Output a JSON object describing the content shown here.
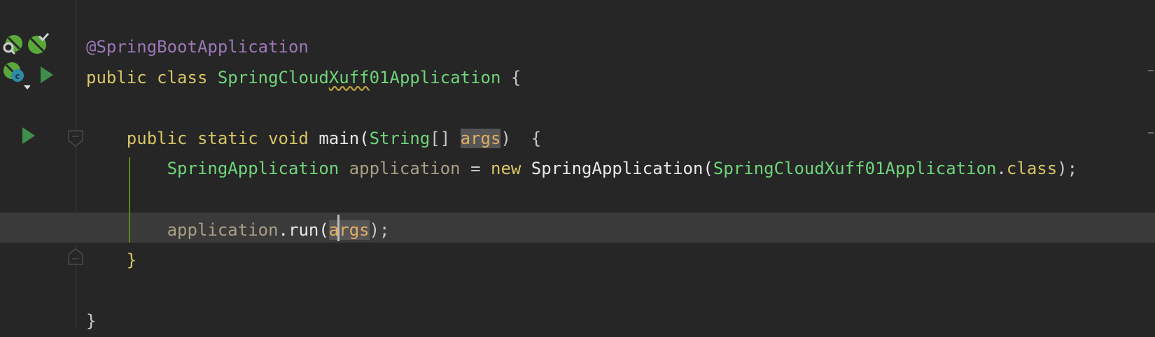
{
  "editor": {
    "lines": [
      [
        {
          "t": "@SpringBootApplication",
          "k": "annotation"
        }
      ],
      [
        {
          "t": "public class ",
          "k": "keyword"
        },
        {
          "t": "SpringCloud",
          "k": "class"
        },
        {
          "t": "Xuff",
          "k": "class typo"
        },
        {
          "t": "01Application",
          "k": "class"
        },
        {
          "t": " {",
          "k": "plain"
        }
      ],
      [],
      [
        {
          "t": "    public static void ",
          "k": "keyword"
        },
        {
          "t": "main(",
          "k": "method"
        },
        {
          "t": "String",
          "k": "class"
        },
        {
          "t": "[] ",
          "k": "plain"
        },
        {
          "t": "args",
          "k": "param-hl"
        },
        {
          "t": ")  {",
          "k": "plain"
        }
      ],
      [
        {
          "t": "        SpringApplication ",
          "k": "class"
        },
        {
          "t": "application",
          "k": "var"
        },
        {
          "t": " = ",
          "k": "plain"
        },
        {
          "t": "new ",
          "k": "keyword"
        },
        {
          "t": "SpringApplication(",
          "k": "method"
        },
        {
          "t": "SpringCloudXuff01Application",
          "k": "class"
        },
        {
          "t": ".",
          "k": "plain"
        },
        {
          "t": "class",
          "k": "keyword"
        },
        {
          "t": ");",
          "k": "plain"
        }
      ],
      [],
      [
        {
          "t": "        application",
          "k": "var"
        },
        {
          "t": ".run(",
          "k": "method"
        },
        {
          "t": "args",
          "k": "param-hl"
        },
        {
          "t": ");",
          "k": "plain"
        }
      ],
      [
        {
          "t": "    }",
          "k": "keyword"
        }
      ],
      [],
      [
        {
          "t": "}",
          "k": "plain"
        }
      ]
    ]
  },
  "gutter": {
    "icons": [
      "spring-bean-search-icon",
      "spring-bean-check-icon",
      "spring-bean-class-icon",
      "run-icon",
      "run-main-icon"
    ]
  },
  "colors": {
    "background": "#262626",
    "current_line": "#3a3a3a",
    "spring_green": "#5aa83a",
    "run_green": "#3f8f4a"
  }
}
